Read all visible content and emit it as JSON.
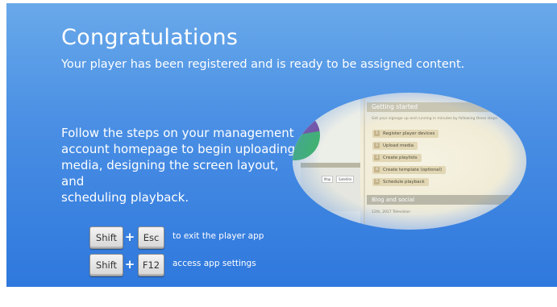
{
  "header": {
    "title": "Congratulations",
    "subtitle": "Your player has been registered and is ready to be assigned content."
  },
  "instructions": {
    "line1": "Follow the steps on your management",
    "line2": "account homepage to begin uploading",
    "line3": "media, designing  the screen layout, and",
    "line4": "scheduling playback."
  },
  "preview": {
    "getting_started_title": "Getting started",
    "intro": "Get your signage up and running in minutes by following these steps",
    "steps": [
      {
        "num": "1",
        "label": "Register player devices"
      },
      {
        "num": "2",
        "label": "Upload media"
      },
      {
        "num": "3",
        "label": "Create playlists"
      },
      {
        "num": "4",
        "label": "Create template (optional)"
      },
      {
        "num": "5",
        "label": "Schedule playback"
      }
    ],
    "map_buttons": [
      "Map",
      "Satellite"
    ],
    "blog_title": "Blog and social",
    "blog_item": "12th, 2017 Television"
  },
  "shortcuts": [
    {
      "key1": "Shift",
      "key2": "Esc",
      "plus": "+",
      "description": "to exit the player app"
    },
    {
      "key1": "Shift",
      "key2": "F12",
      "plus": "+",
      "description": "access app settings"
    }
  ],
  "colors": {
    "background_top": "#69a9ea",
    "background_bottom": "#2f78dd",
    "text": "#ffffff",
    "key_face": "#e6e6e6"
  }
}
